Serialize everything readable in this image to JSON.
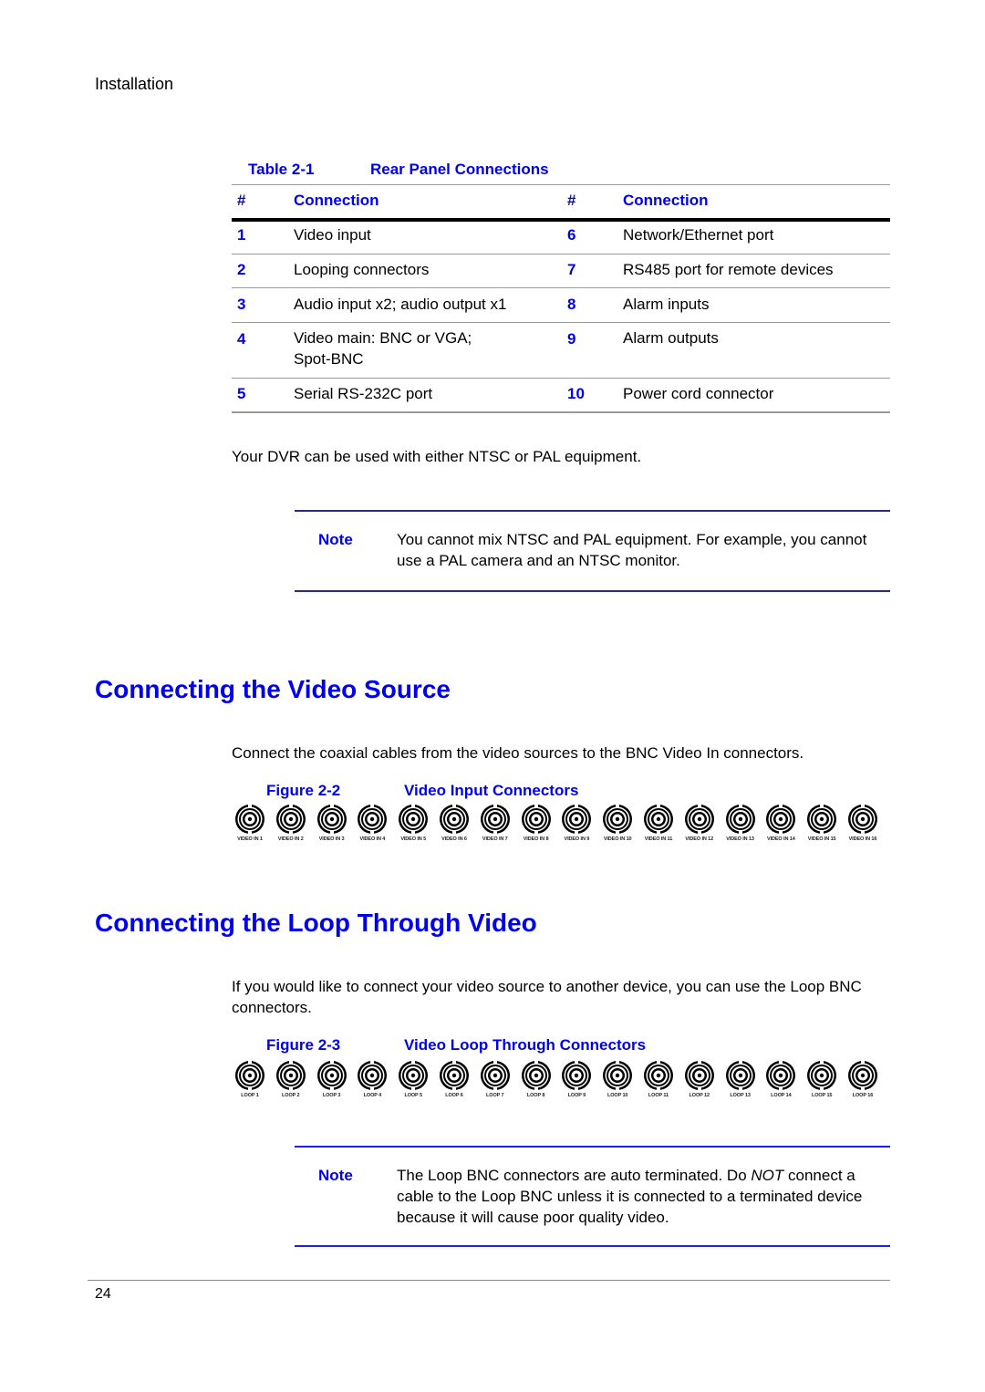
{
  "running_head": "Installation",
  "table": {
    "caption_label": "Table",
    "caption_number": "2-1",
    "caption_title": "Rear Panel Connections",
    "headers": {
      "num_left": "#",
      "conn_left": "Connection",
      "num_right": "#",
      "conn_right": "Connection"
    },
    "rows": [
      {
        "n1": "1",
        "c1": "Video input",
        "n2": "6",
        "c2": "Network/Ethernet port"
      },
      {
        "n1": "2",
        "c1": "Looping connectors",
        "n2": "7",
        "c2": "RS485 port for remote devices"
      },
      {
        "n1": "3",
        "c1": "Audio input x2; audio output x1",
        "n2": "8",
        "c2": "Alarm inputs"
      },
      {
        "n1": "4",
        "c1": "Video main: BNC or VGA;",
        "c1b": "Spot-BNC",
        "n2": "9",
        "c2": "Alarm outputs"
      },
      {
        "n1": "5",
        "c1": "Serial RS-232C port",
        "n2": "10",
        "c2": "Power cord connector"
      }
    ]
  },
  "intro_text": "Your DVR can be used with either NTSC or PAL equipment.",
  "note1": {
    "label": "Note",
    "text": "You cannot mix NTSC and PAL equipment. For example, you cannot use a PAL camera and an NTSC monitor."
  },
  "section1": {
    "heading": "Connecting the Video Source",
    "body": "Connect the coaxial cables from the video sources to the BNC Video In connectors.",
    "figure_label": "Figure",
    "figure_number": "2-2",
    "figure_title": "Video Input Connectors",
    "connectors": [
      "VIDEO IN 1",
      "VIDEO IN 2",
      "VIDEO IN 3",
      "VIDEO IN 4",
      "VIDEO IN 5",
      "VIDEO IN 6",
      "VIDEO IN 7",
      "VIDEO IN 8",
      "VIDEO IN 9",
      "VIDEO IN 10",
      "VIDEO IN 11",
      "VIDEO IN 12",
      "VIDEO IN 13",
      "VIDEO IN 14",
      "VIDEO IN 15",
      "VIDEO IN 16"
    ]
  },
  "section2": {
    "heading": "Connecting the Loop Through Video",
    "body": "If you would like to connect your video source to another device, you can use the Loop BNC connectors.",
    "figure_label": "Figure",
    "figure_number": "2-3",
    "figure_title": "Video Loop Through Connectors",
    "connectors": [
      "LOOP 1",
      "LOOP 2",
      "LOOP 3",
      "LOOP 4",
      "LOOP 5",
      "LOOP 6",
      "LOOP 7",
      "LOOP 8",
      "LOOP 9",
      "LOOP 10",
      "LOOP 11",
      "LOOP 12",
      "LOOP 13",
      "LOOP 14",
      "LOOP 15",
      "LOOP 16"
    ]
  },
  "note2": {
    "label": "Note",
    "text_before": "The Loop BNC connectors are auto terminated. Do ",
    "text_emph": "NOT",
    "text_after": " connect a cable to the Loop BNC unless it is connected to a terminated device because it will cause poor quality video."
  },
  "page_number": "24",
  "colors": {
    "accent": "#0000f0",
    "rule": "#9a9a9a",
    "note_rule": "#2020e0"
  }
}
